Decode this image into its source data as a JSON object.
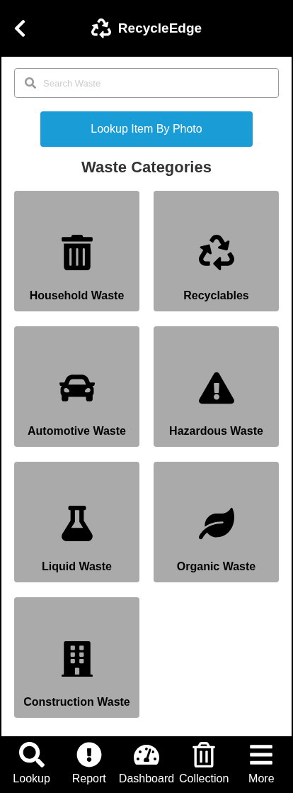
{
  "header": {
    "title": "RecycleEdge"
  },
  "search": {
    "placeholder": "Search Waste"
  },
  "photo_button": "Lookup Item By Photo",
  "heading": "Waste Categories",
  "categories": [
    {
      "kind": "trash",
      "label": "Household Waste"
    },
    {
      "kind": "recycle",
      "label": "Recyclables"
    },
    {
      "kind": "car",
      "label": "Automotive Waste"
    },
    {
      "kind": "warning",
      "label": "Hazardous Waste"
    },
    {
      "kind": "flask",
      "label": "Liquid Waste"
    },
    {
      "kind": "leaf",
      "label": "Organic Waste"
    },
    {
      "kind": "building",
      "label": "Construction Waste"
    }
  ],
  "tab_bar": [
    {
      "kind": "search",
      "label": "Lookup"
    },
    {
      "kind": "alert",
      "label": "Report"
    },
    {
      "kind": "gauge",
      "label": "Dashboard"
    },
    {
      "kind": "trash",
      "label": "Collection"
    },
    {
      "kind": "menu",
      "label": "More"
    }
  ]
}
